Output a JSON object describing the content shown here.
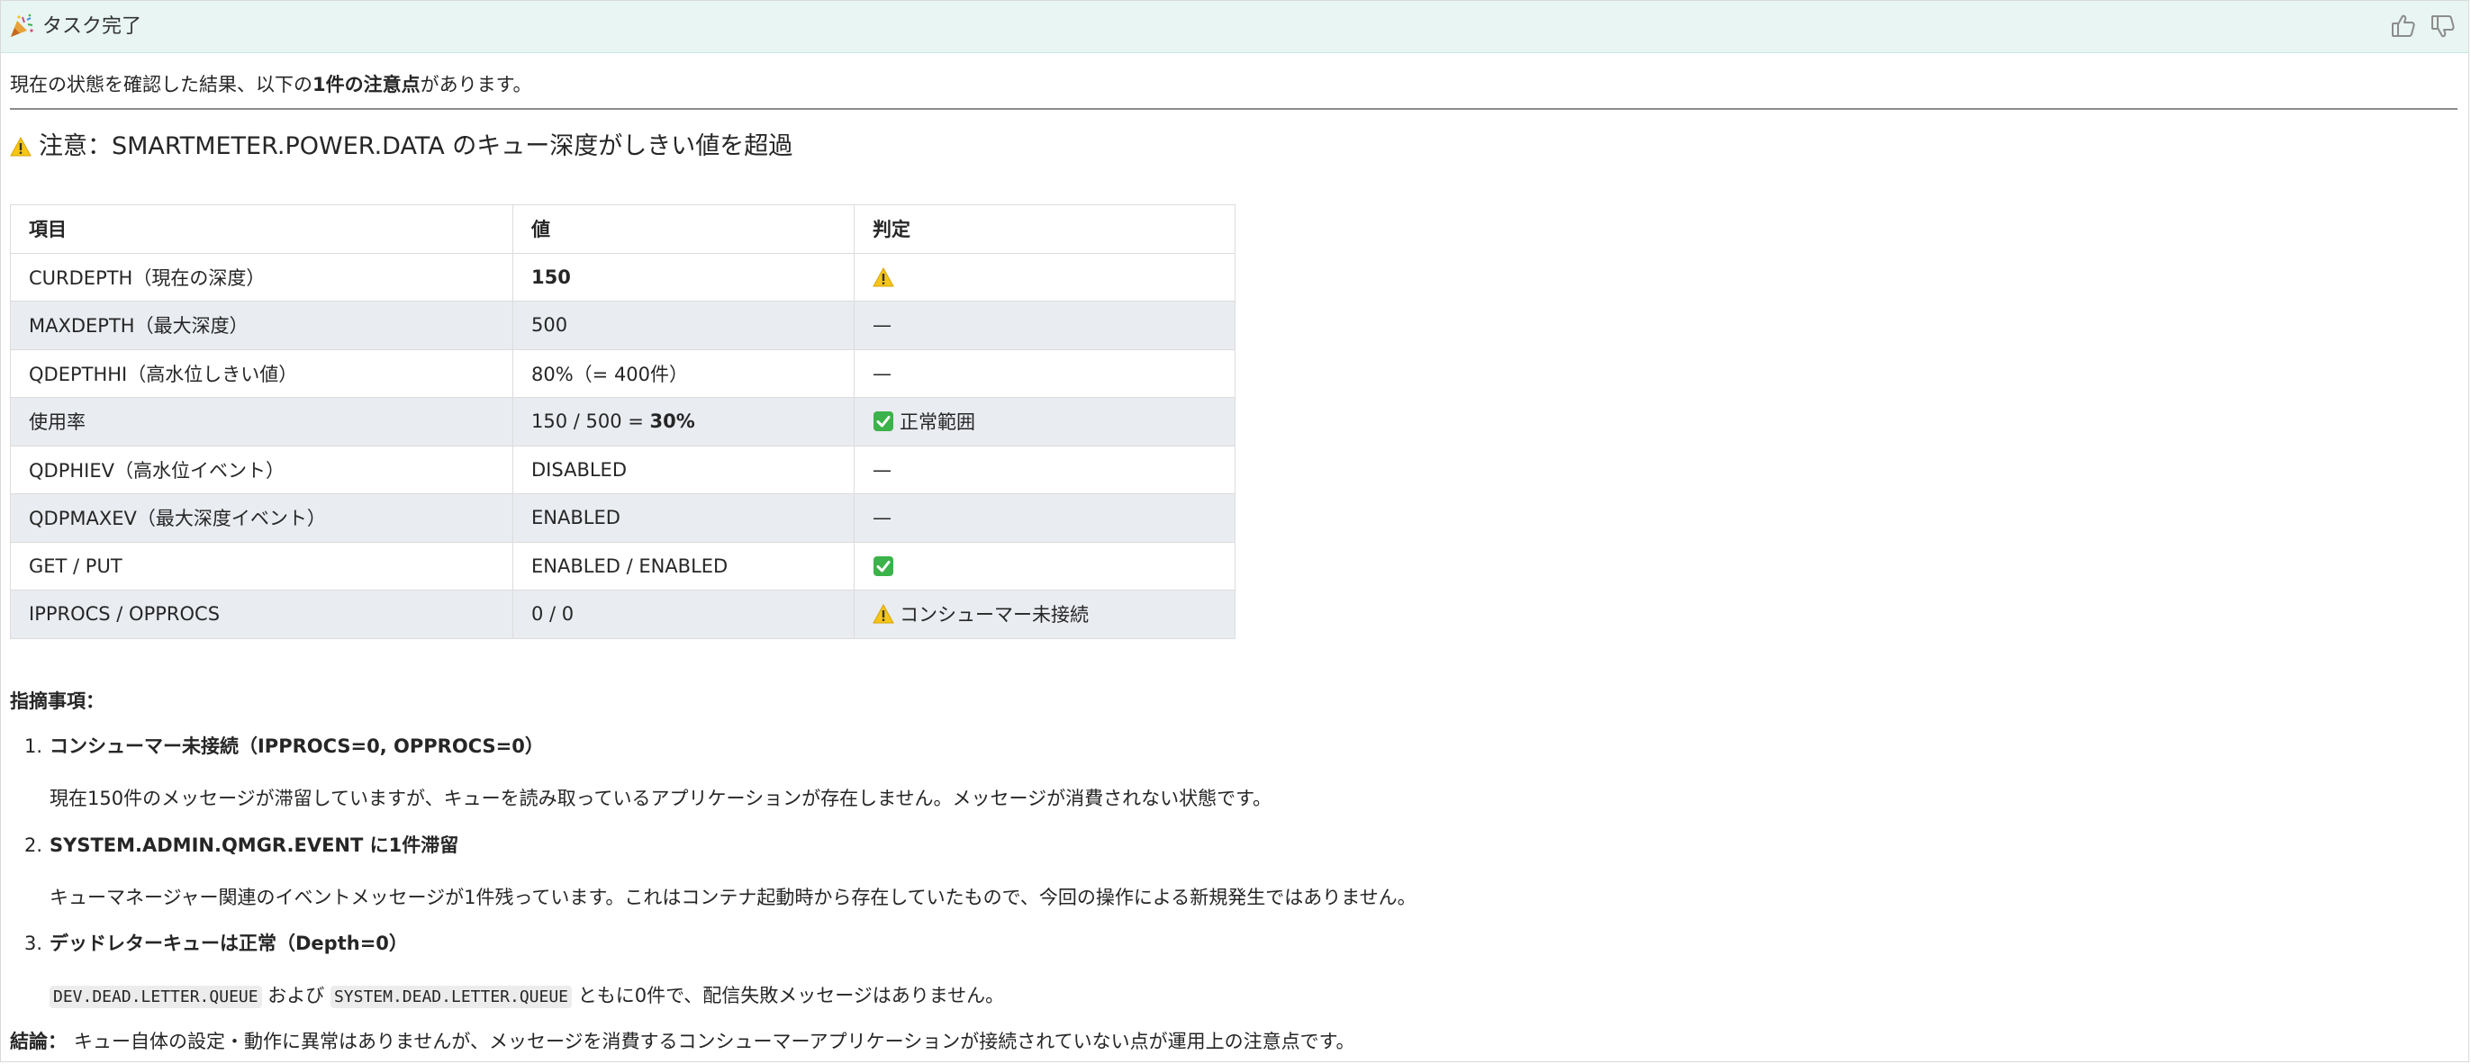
{
  "header": {
    "title": "タスク完了",
    "party_icon": "party-popper-icon",
    "thumbs_up_icon": "thumbs-up-icon",
    "thumbs_down_icon": "thumbs-down-icon"
  },
  "intro": {
    "prefix": "現在の状態を確認した結果、以下の",
    "emphasis": "1件の注意点",
    "suffix": "があります。"
  },
  "heading": {
    "icon": "warning-icon",
    "text": "注意：SMARTMETER.POWER.DATA のキュー深度がしきい値を超過"
  },
  "table": {
    "headers": [
      "項目",
      "値",
      "判定"
    ],
    "rows": [
      {
        "item": "CURDEPTH（現在の深度）",
        "value": "150",
        "value_bold": true,
        "judge": "",
        "judge_icon": "warning-icon"
      },
      {
        "item": "MAXDEPTH（最大深度）",
        "value": "500",
        "judge": "—"
      },
      {
        "item": "QDEPTHHI（高水位しきい値）",
        "value": "80%（= 400件）",
        "judge": "—"
      },
      {
        "item": "使用率",
        "value": "150 / 500 = ",
        "value_bold_suffix": "30%",
        "judge": "正常範囲",
        "judge_icon": "check-icon"
      },
      {
        "item": "QDPHIEV（高水位イベント）",
        "value": "DISABLED",
        "judge": "—"
      },
      {
        "item": "QDPMAXEV（最大深度イベント）",
        "value": "ENABLED",
        "judge": "—"
      },
      {
        "item": "GET / PUT",
        "value": "ENABLED / ENABLED",
        "judge": "",
        "judge_icon": "check-icon"
      },
      {
        "item": "IPPROCS / OPPROCS",
        "value": "0 / 0",
        "judge": "コンシューマー未接続",
        "judge_icon": "warning-icon"
      }
    ]
  },
  "findings": {
    "title": "指摘事項：",
    "items": [
      {
        "num": "1.",
        "title": "コンシューマー未接続（IPPROCS=0, OPPROCS=0）",
        "body": "現在150件のメッセージが滞留していますが、キューを読み取っているアプリケーションが存在しません。メッセージが消費されない状態です。"
      },
      {
        "num": "2.",
        "title": "SYSTEM.ADMIN.QMGR.EVENT に1件滞留",
        "body": "キューマネージャー関連のイベントメッセージが1件残っています。これはコンテナ起動時から存在していたもので、今回の操作による新規発生ではありません。"
      },
      {
        "num": "3.",
        "title": "デッドレターキューは正常（Depth=0）",
        "code1": "DEV.DEAD.LETTER.QUEUE",
        "mid": " および ",
        "code2": "SYSTEM.DEAD.LETTER.QUEUE",
        "tail": " ともに0件で、配信失敗メッセージはありません。"
      }
    ]
  },
  "conclusion": {
    "label": "結論：",
    "text": "キュー自体の設定・動作に異常はありませんが、メッセージを消費するコンシューマーアプリケーションが接続されていない点が運用上の注意点です。"
  },
  "colors": {
    "header_bg": "#e8f5f2",
    "row_alt_bg": "#e9ecf1",
    "warning": "#f5c518",
    "check": "#3cb34a"
  }
}
